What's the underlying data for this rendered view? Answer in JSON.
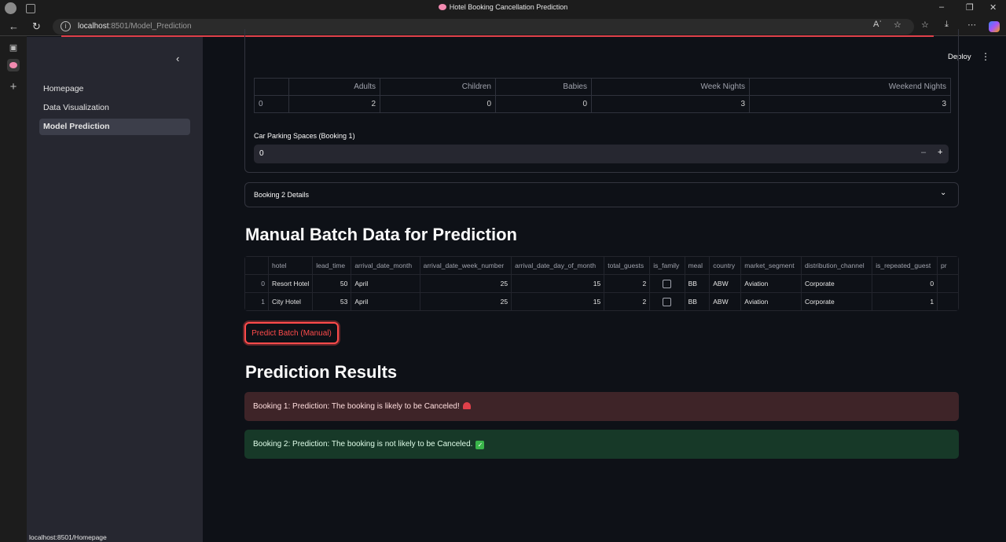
{
  "browser": {
    "window_title": "Hotel Booking Cancellation Prediction",
    "url_host": "localhost",
    "url_rest": ":8501/Model_Prediction",
    "status_url": "localhost:8501/Homepage"
  },
  "header": {
    "deploy_label": "Deploy"
  },
  "sidebar": {
    "items": [
      {
        "label": "Homepage"
      },
      {
        "label": "Data Visualization"
      },
      {
        "label": "Model Prediction"
      }
    ]
  },
  "booking1": {
    "guest_table": {
      "headers": [
        "",
        "Adults",
        "Children",
        "Babies",
        "Week Nights",
        "Weekend Nights"
      ],
      "row": [
        "0",
        "2",
        "0",
        "0",
        "3",
        "3"
      ]
    },
    "parking_label": "Car Parking Spaces (Booking 1)",
    "parking_value": "0"
  },
  "booking2": {
    "label": "Booking 2 Details"
  },
  "manual": {
    "title": "Manual Batch Data for Prediction",
    "headers": [
      "",
      "hotel",
      "lead_time",
      "arrival_date_month",
      "arrival_date_week_number",
      "arrival_date_day_of_month",
      "total_guests",
      "is_family",
      "meal",
      "country",
      "market_segment",
      "distribution_channel",
      "is_repeated_guest",
      "pr"
    ],
    "rows": [
      [
        "0",
        "Resort Hotel",
        "50",
        "April",
        "25",
        "15",
        "2",
        "",
        "BB",
        "ABW",
        "Aviation",
        "Corporate",
        "0",
        ""
      ],
      [
        "1",
        "City Hotel",
        "53",
        "April",
        "25",
        "15",
        "2",
        "",
        "BB",
        "ABW",
        "Aviation",
        "Corporate",
        "1",
        ""
      ]
    ],
    "button_label": "Predict Batch (Manual)"
  },
  "results": {
    "title": "Prediction Results",
    "booking1": "Booking 1: Prediction: The booking is likely to be Canceled!",
    "booking2": "Booking 2: Prediction: The booking is not likely to be Canceled.",
    "status_colors": {
      "error_bg": "#3e2428",
      "success_bg": "#173928",
      "accent": "#ff4b4b"
    }
  }
}
